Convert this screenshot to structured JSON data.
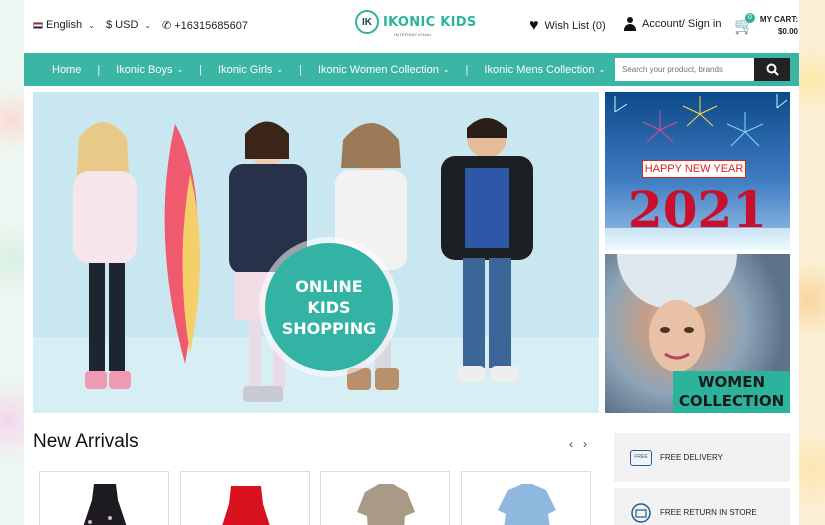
{
  "topbar": {
    "language": "English",
    "currency": "$ USD",
    "phone": "+16315685607",
    "wishlist": "Wish List (0)",
    "account": "Account/ Sign in",
    "cart_label": "MY CART:",
    "cart_total": "$0.00",
    "cart_count": "0"
  },
  "logo": {
    "mark": "IK",
    "name": "IKONIC KIDS",
    "sub": "INTERNATIONAL"
  },
  "nav": {
    "items": [
      {
        "label": "Home"
      },
      {
        "label": "Ikonic Boys"
      },
      {
        "label": "Ikonic Girls"
      },
      {
        "label": "Ikonic Women Collection"
      },
      {
        "label": "Ikonic Mens Collection"
      }
    ],
    "search_placeholder": "Search your product, brands"
  },
  "hero": {
    "line1": "ONLINE",
    "line2": "KIDS",
    "line3": "SHOPPING"
  },
  "newyear": {
    "tag": "HAPPY NEW YEAR",
    "year": "2021"
  },
  "women": {
    "line1": "WOMEN",
    "line2": "COLLECTION"
  },
  "arrivals": {
    "title": "New Arrivals"
  },
  "services": {
    "delivery": "FREE DELIVERY",
    "return": "FREE RETURN IN STORE",
    "free_tag": "FREE"
  },
  "colors": {
    "accent": "#3bb6a4",
    "brand": "#2bb39b"
  }
}
